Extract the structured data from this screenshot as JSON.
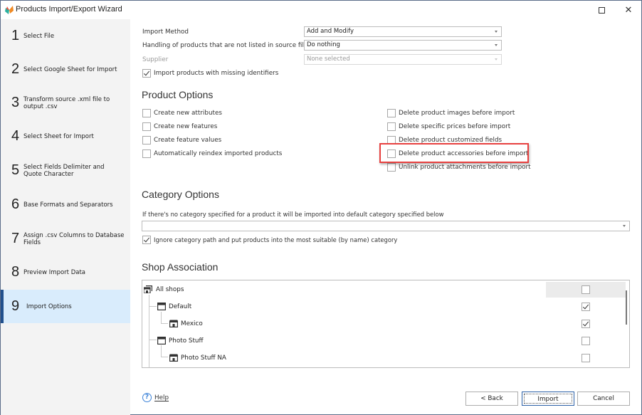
{
  "window": {
    "title": "Products Import/Export Wizard",
    "maximize_icon": "maximize-icon",
    "close_icon": "close-icon"
  },
  "sidebar": {
    "steps": [
      {
        "number": "1",
        "label": "Select File"
      },
      {
        "number": "2",
        "label": "Select Google Sheet for Import"
      },
      {
        "number": "3",
        "label": "Transform source .xml file to output .csv"
      },
      {
        "number": "4",
        "label": "Select Sheet for Import"
      },
      {
        "number": "5",
        "label": "Select Fields Delimiter and Quote Character"
      },
      {
        "number": "6",
        "label": "Base Formats and Separators"
      },
      {
        "number": "7",
        "label": "Assign .csv Columns to Database Fields"
      },
      {
        "number": "8",
        "label": "Preview Import Data"
      },
      {
        "number": "9",
        "label": "Import Options",
        "active": true
      }
    ]
  },
  "general": {
    "import_method_label": "Import Method",
    "import_method_value": "Add and Modify",
    "handling_label": "Handling of products that are not listed in source file",
    "handling_value": "Do nothing",
    "supplier_label": "Supplier",
    "supplier_value": "None selected",
    "missing_identifiers_label": "Import products with missing identifiers",
    "missing_identifiers_checked": true
  },
  "product_options": {
    "title": "Product Options",
    "left": [
      {
        "label": "Create new attributes",
        "checked": false
      },
      {
        "label": "Create new features",
        "checked": false
      },
      {
        "label": "Create feature values",
        "checked": false
      },
      {
        "label": "Automatically reindex imported products",
        "checked": false
      }
    ],
    "right": [
      {
        "label": "Delete product images before import",
        "checked": false
      },
      {
        "label": "Delete specific prices before import",
        "checked": false
      },
      {
        "label": "Delete product customized fields",
        "checked": false
      },
      {
        "label": "Delete product accessories before import",
        "checked": false,
        "highlighted": true
      },
      {
        "label": "Unlink product attachments before import",
        "checked": false
      }
    ]
  },
  "category_options": {
    "title": "Category Options",
    "description": "If there's no category specified for a product it will be imported into default category specified below",
    "default_category_value": "",
    "ignore_path_label": "Ignore category path and put products into the most suitable (by name) category",
    "ignore_path_checked": true
  },
  "shop_association": {
    "title": "Shop Association",
    "items": [
      {
        "label": "All shops",
        "icon": "shop-group-icon",
        "level": 0,
        "checked": false,
        "selected": true
      },
      {
        "label": "Default",
        "icon": "window-icon",
        "level": 1,
        "checked": true
      },
      {
        "label": "Mexico",
        "icon": "store-icon",
        "level": 2,
        "checked": true
      },
      {
        "label": "Photo Stuff",
        "icon": "window-icon",
        "level": 1,
        "checked": false
      },
      {
        "label": "Photo Stuff NA",
        "icon": "store-icon",
        "level": 2,
        "checked": false
      }
    ]
  },
  "footer": {
    "help_label": "Help",
    "back_label": "< Back",
    "import_label": "Import",
    "cancel_label": "Cancel"
  },
  "colors": {
    "accent": "#21508d",
    "active_step_bg": "#d9ecfc",
    "highlight_border": "#e8403f",
    "help_icon": "#3b82d8"
  }
}
